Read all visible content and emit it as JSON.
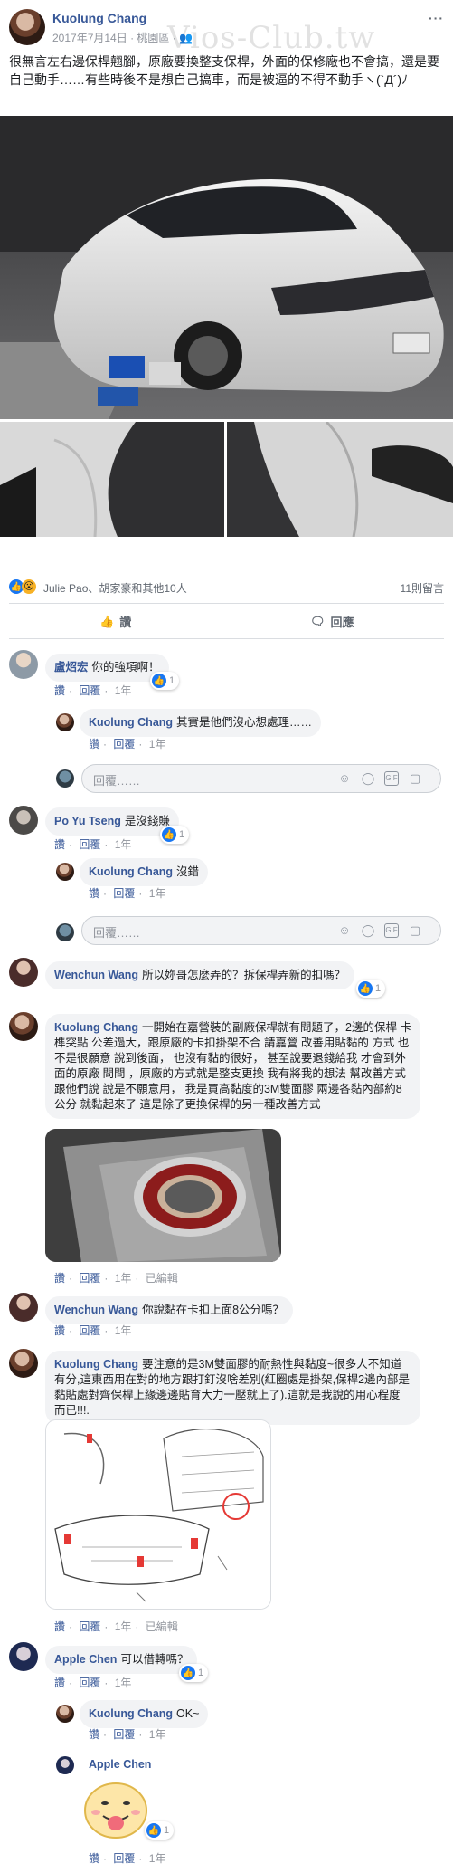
{
  "watermark": "Vios-Club.tw",
  "post": {
    "author": "Kuolung Chang",
    "date": "2017年7月14日",
    "location": "桃園區",
    "text": "很無言左右邊保桿翹腳，原廠要換整支保桿，外面的保修廠也不會搞，還是要自己動手……有些時後不是想自己搞車，而是被逼的不得不動手ヽ(`Д´)ﾉ"
  },
  "reactions": {
    "summary": "Julie Pao、胡家豪和其他10人",
    "comment_count": "11則留言"
  },
  "action_bar": {
    "like": "讚",
    "reply": "回應"
  },
  "labels": {
    "like": "讚",
    "reply": "回覆",
    "edited": "已編輯",
    "reply_placeholder": "回覆……"
  },
  "comments": [
    {
      "author": "盧炤宏",
      "text": "你的強項啊！",
      "time": "1年",
      "likes": "1"
    },
    {
      "author": "Kuolung Chang",
      "text": "其實是他們沒心想處理……",
      "time": "1年"
    },
    {
      "author": "Po Yu Tseng",
      "text": "是沒錢賺",
      "time": "1年",
      "likes": "1"
    },
    {
      "author": "Kuolung Chang",
      "text": "沒錯",
      "time": "1年"
    },
    {
      "author": "Wenchun Wang",
      "text": "所以妳哥怎麼弄的？拆保桿弄新的扣嗎？",
      "time": "1年",
      "likes": "1"
    },
    {
      "author": "Kuolung Chang",
      "text": "一開始在嘉營裝的副廠保桿就有問題了，2邊的保桿 卡榫突點 公差過大，跟原廠的卡扣掛架不合 請嘉營 改善用貼黏的 方式 也不是很願意 說到後面， 也沒有黏的很好， 甚至說要退錢給我 才會到外面的原廠 問問 ，原廠的方式就是整支更換 我有將我的想法 幫改善方式跟他們說 說是不願意用， 我是買高黏度的3M雙面膠 兩邊各黏內部約8公分 就黏起來了 這是除了更換保桿的另一種改善方式",
      "time": "1年"
    },
    {
      "author": "Wenchun Wang",
      "text": "你說黏在卡扣上面8公分嗎？",
      "time": "1年"
    },
    {
      "author": "Kuolung Chang",
      "text": "要注意的是3M雙面膠的耐熱性與黏度~很多人不知道有分,這東西用在對的地方跟打釘沒啥差別(紅圈處是掛架,保桿2邊內部是黏貼處對齊保桿上緣邊邊貼育大力一壓就上了).這就是我說的用心程度而已!!!.",
      "time": "1年"
    },
    {
      "author": "Apple Chen",
      "text": "可以借轉嗎？",
      "time": "1年",
      "likes": "1"
    },
    {
      "author": "Kuolung Chang",
      "text": "OK~",
      "time": "1年"
    },
    {
      "author": "Apple Chen",
      "text": "",
      "time": "1年",
      "likes": "1"
    }
  ]
}
